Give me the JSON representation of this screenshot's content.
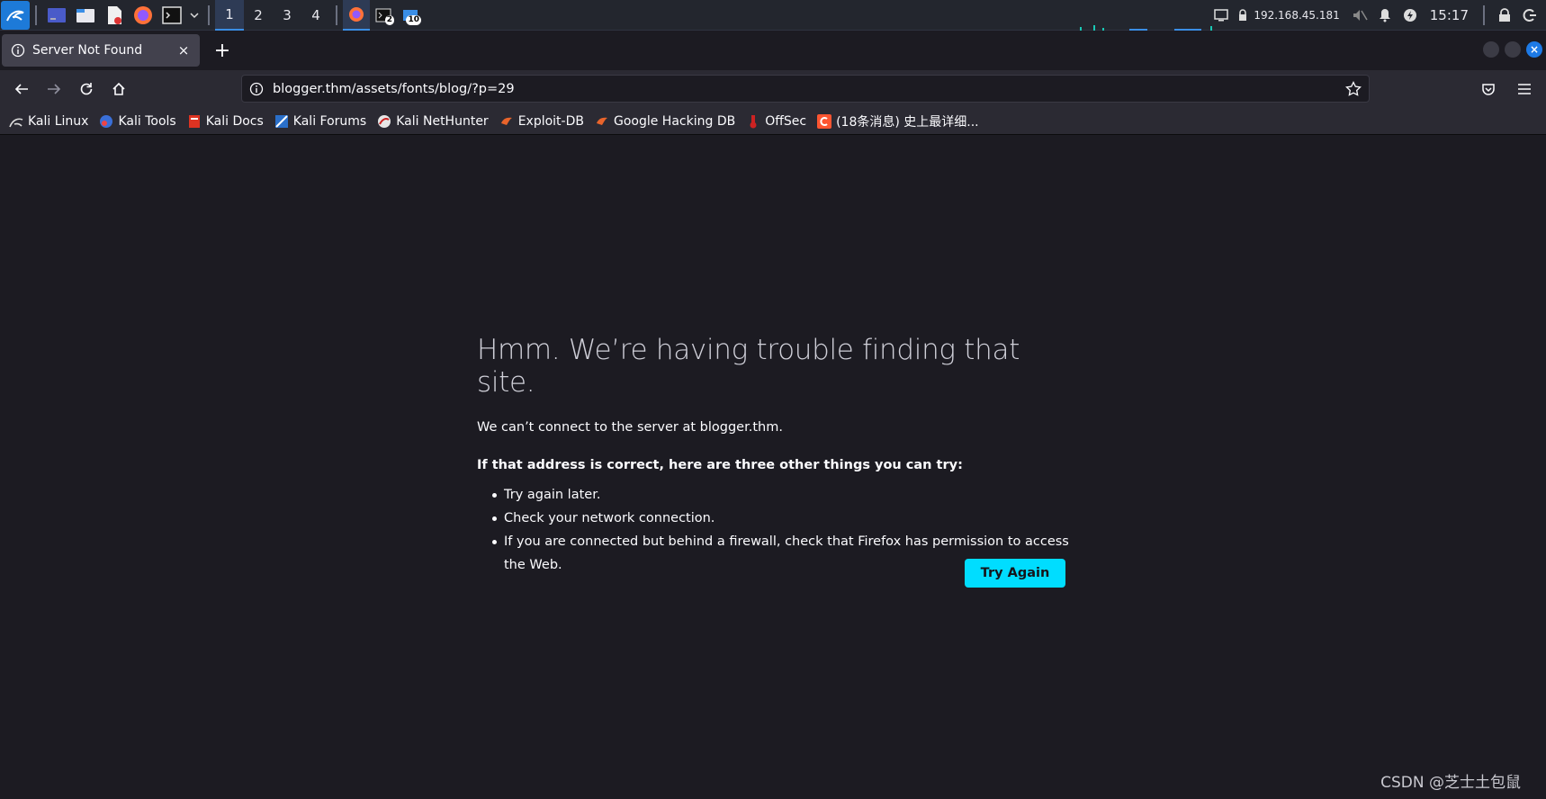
{
  "taskbar": {
    "workspaces": [
      "1",
      "2",
      "3",
      "4"
    ],
    "active_workspace": "1",
    "terminal_badge": "2",
    "files_badge": "10",
    "ip_address": "192.168.45.181",
    "clock": "15:17"
  },
  "browser": {
    "tab": {
      "title": "Server Not Found",
      "close_label": "×"
    },
    "newtab_label": "+",
    "url": "blogger.thm/assets/fonts/blog/?p=29"
  },
  "bookmarks": [
    {
      "label": "Kali Linux",
      "icon": "kali-dragon-icon"
    },
    {
      "label": "Kali Tools",
      "icon": "kali-tools-icon"
    },
    {
      "label": "Kali Docs",
      "icon": "kali-docs-icon"
    },
    {
      "label": "Kali Forums",
      "icon": "kali-forums-icon"
    },
    {
      "label": "Kali NetHunter",
      "icon": "nethunter-icon"
    },
    {
      "label": "Exploit-DB",
      "icon": "exploit-db-icon"
    },
    {
      "label": "Google Hacking DB",
      "icon": "ghdb-icon"
    },
    {
      "label": "OffSec",
      "icon": "offsec-icon"
    },
    {
      "label": "(18条消息) 史上最详细...",
      "icon": "csdn-icon"
    }
  ],
  "error_page": {
    "title": "Hmm. We’re having trouble finding that site.",
    "description": "We can’t connect to the server at blogger.thm.",
    "subtitle": "If that address is correct, here are three other things you can try:",
    "tips": [
      "Try again later.",
      "Check your network connection.",
      "If you are connected but behind a firewall, check that Firefox has permission to access the Web."
    ],
    "try_again_label": "Try Again"
  },
  "watermark": "CSDN @芝士土包鼠",
  "colors": {
    "accent": "#00ddff",
    "content_bg": "#1c1b22",
    "toolbar_bg": "#2b2a33"
  }
}
